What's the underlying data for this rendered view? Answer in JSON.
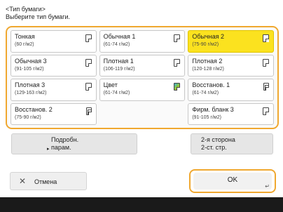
{
  "header": {
    "title": "<Тип бумаги>",
    "prompt": "Выберите тип бумаги."
  },
  "tiles": [
    {
      "name": "Тонкая",
      "weight": "(60 г/м2)",
      "icon": "paper-icon",
      "selected": false
    },
    {
      "name": "Обычная 1",
      "weight": "(61-74 г/м2)",
      "icon": "paper-icon",
      "selected": false
    },
    {
      "name": "Обычная 2",
      "weight": "(75-90 г/м2)",
      "icon": "paper-icon",
      "selected": true
    },
    {
      "name": "Обычная 3",
      "weight": "(91-105 г/м2)",
      "icon": "paper-icon",
      "selected": false
    },
    {
      "name": "Плотная 1",
      "weight": "(106-119 г/м2)",
      "icon": "paper-icon",
      "selected": false
    },
    {
      "name": "Плотная 2",
      "weight": "(120-128 г/м2)",
      "icon": "paper-icon",
      "selected": false
    },
    {
      "name": "Плотная 3",
      "weight": "(129-163 г/м2)",
      "icon": "paper-icon",
      "selected": false
    },
    {
      "name": "Цвет",
      "weight": "(61-74 г/м2)",
      "icon": "color-paper-icon",
      "selected": false
    },
    {
      "name": "Восстанов. 1",
      "weight": "(61-74 г/м2)",
      "icon": "recycled-paper-icon",
      "selected": false
    },
    {
      "name": "Восстанов. 2",
      "weight": "(75-90 г/м2)",
      "icon": "recycled-paper-icon",
      "selected": false
    },
    {
      "name": "Фирм. бланк 3",
      "weight": "(91-105 г/м2)",
      "icon": "paper-icon",
      "selected": false
    }
  ],
  "buttons": {
    "details_line1": "Подробн.",
    "details_line2": "парам.",
    "second_side_line1": "2-я сторона",
    "second_side_line2": "2-ст. стр.",
    "cancel": "Отмена",
    "ok": "OK"
  },
  "colors": {
    "accent": "#f0a830",
    "selected": "#fbe21f"
  }
}
